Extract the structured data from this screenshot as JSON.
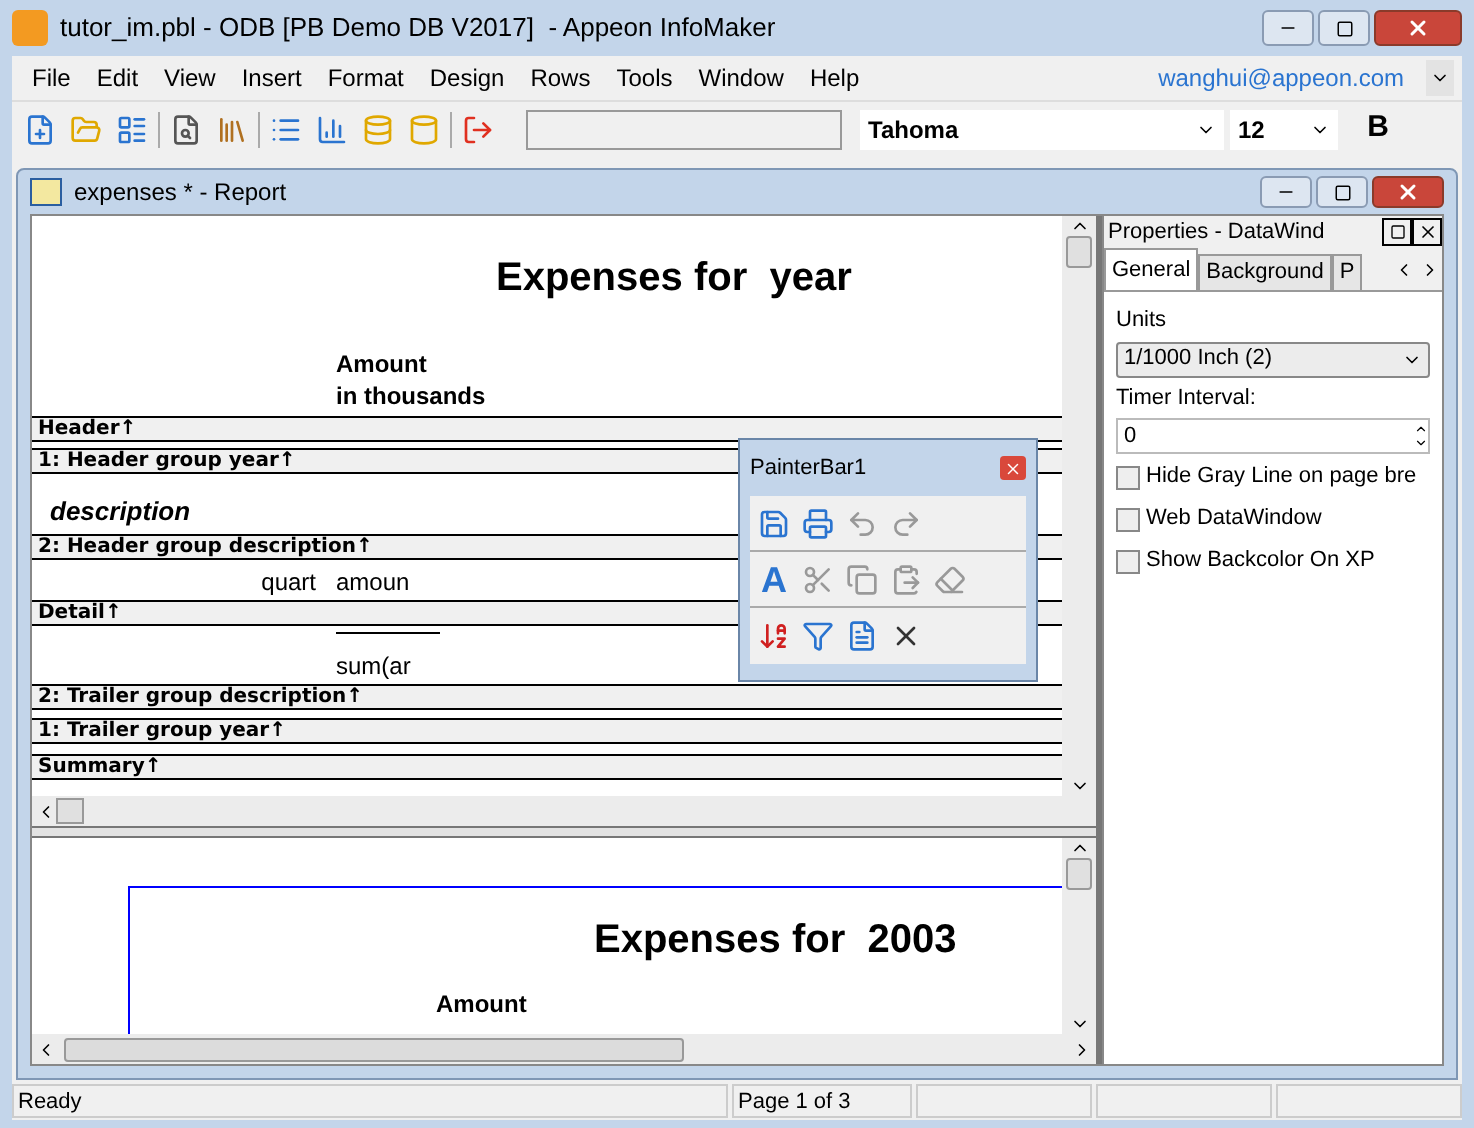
{
  "window": {
    "title": "tutor_im.pbl - ODB [PB Demo DB V2017]  - Appeon InfoMaker"
  },
  "menu": {
    "items": [
      "File",
      "Edit",
      "View",
      "Insert",
      "Format",
      "Design",
      "Rows",
      "Tools",
      "Window",
      "Help"
    ],
    "user": "wanghui@appeon.com"
  },
  "toolbar": {
    "font": "Tahoma",
    "size": "12",
    "bold": "B"
  },
  "document": {
    "title": "expenses * - Report",
    "bands": [
      {
        "label": "Header↑",
        "fields": [
          "Expenses for  year",
          "Amount",
          "in thousands"
        ]
      },
      {
        "label": "1: Header group year↑"
      },
      {
        "label": "2: Header group description↑",
        "fields": [
          "description"
        ]
      },
      {
        "label": "Detail↑",
        "fields": [
          "quart",
          "amoun"
        ]
      },
      {
        "label": "2: Trailer group description↑",
        "fields": [
          "sum(ar"
        ]
      },
      {
        "label": "1: Trailer group year↑"
      },
      {
        "label": "Summary↑"
      }
    ],
    "preview": {
      "title": "Expenses for  2003",
      "heading": "Amount"
    }
  },
  "painter_bar": {
    "title": "PainterBar1",
    "font_color": "A"
  },
  "properties": {
    "title": "Properties - DataWind",
    "tabs": [
      {
        "label": "General",
        "selected": true
      },
      {
        "label": "Background",
        "selected": false
      },
      {
        "label": "P",
        "selected": false
      }
    ],
    "units_label": "Units",
    "units_value": "1/1000 Inch (2)",
    "timer_label": "Timer Interval:",
    "timer_value": "0",
    "options": [
      {
        "label": "Hide Gray Line on page bre",
        "checked": false
      },
      {
        "label": "Web DataWindow",
        "checked": false
      },
      {
        "label": "Show Backcolor On XP",
        "checked": false
      }
    ]
  },
  "status_bar": [
    "Ready",
    "Page 1 of 3"
  ]
}
